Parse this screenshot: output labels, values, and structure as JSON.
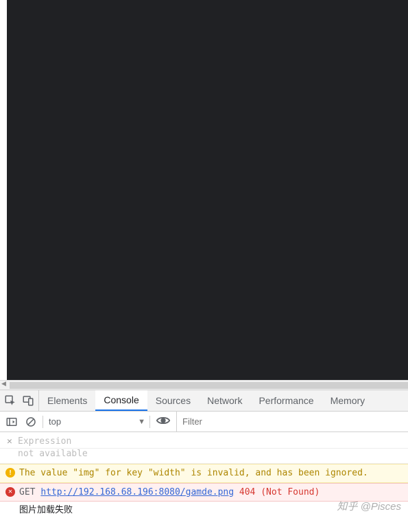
{
  "tabs": {
    "items": [
      {
        "label": "Elements",
        "active": false
      },
      {
        "label": "Console",
        "active": true
      },
      {
        "label": "Sources",
        "active": false
      },
      {
        "label": "Network",
        "active": false
      },
      {
        "label": "Performance",
        "active": false
      },
      {
        "label": "Memory",
        "active": false
      }
    ]
  },
  "toolbar": {
    "context": "top",
    "filter_placeholder": "Filter"
  },
  "expression": {
    "label": "Expression",
    "value": "not available"
  },
  "messages": {
    "warning": "The value \"img\" for key \"width\" is invalid, and has been ignored.",
    "error": {
      "method": "GET",
      "url": "http://192.168.68.196:8080/gamde.png",
      "status": "404 (Not Found)"
    },
    "log": "图片加载失败"
  },
  "watermark": "知乎 @Pisces"
}
